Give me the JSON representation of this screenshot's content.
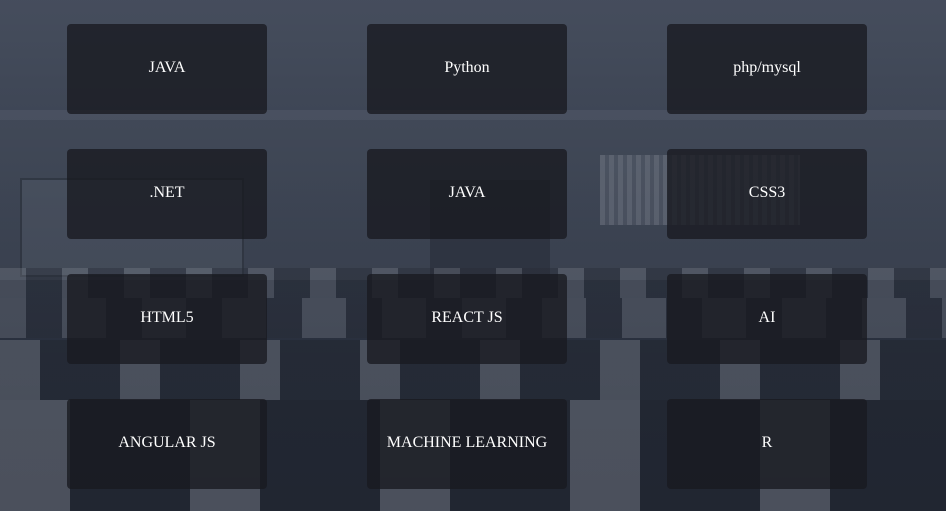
{
  "courses": [
    {
      "label": "JAVA"
    },
    {
      "label": "Python"
    },
    {
      "label": "php/mysql"
    },
    {
      "label": ".NET"
    },
    {
      "label": "JAVA"
    },
    {
      "label": "CSS3"
    },
    {
      "label": "HTML5"
    },
    {
      "label": "REACT JS"
    },
    {
      "label": "AI"
    },
    {
      "label": "ANGULAR JS"
    },
    {
      "label": "MACHINE LEARNING"
    },
    {
      "label": "R"
    }
  ],
  "colors": {
    "card_background": "#181a20",
    "card_text": "#ffffff",
    "overlay": "#262c38"
  },
  "background_image": "computer-lab-classroom"
}
